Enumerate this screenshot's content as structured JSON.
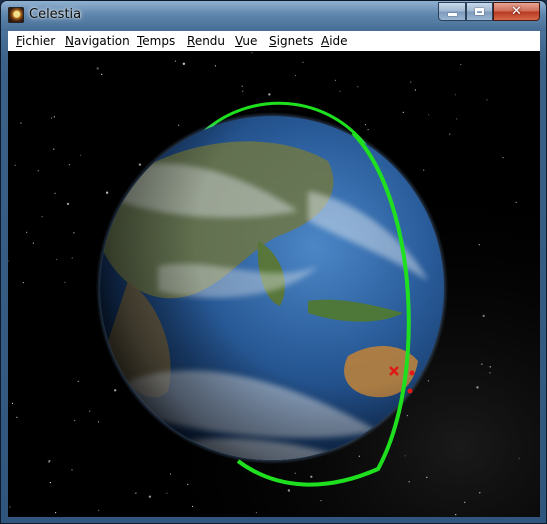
{
  "window": {
    "title": "Celestia",
    "icon": "celestia-app-icon",
    "controls": {
      "minimize_icon": "minimize-icon",
      "maximize_icon": "maximize-icon",
      "close_icon": "close-icon",
      "close_glyph": "✕"
    }
  },
  "menubar": {
    "items": [
      {
        "label": "Fichier"
      },
      {
        "label": "Navigation"
      },
      {
        "label": "Temps"
      },
      {
        "label": "Rendu"
      },
      {
        "label": "Vue"
      },
      {
        "label": "Signets"
      },
      {
        "label": "Aide"
      }
    ]
  },
  "viewport": {
    "scene": "earth-with-orbit",
    "orbit_color": "#1fe01f",
    "marker_color": "#e01818"
  }
}
